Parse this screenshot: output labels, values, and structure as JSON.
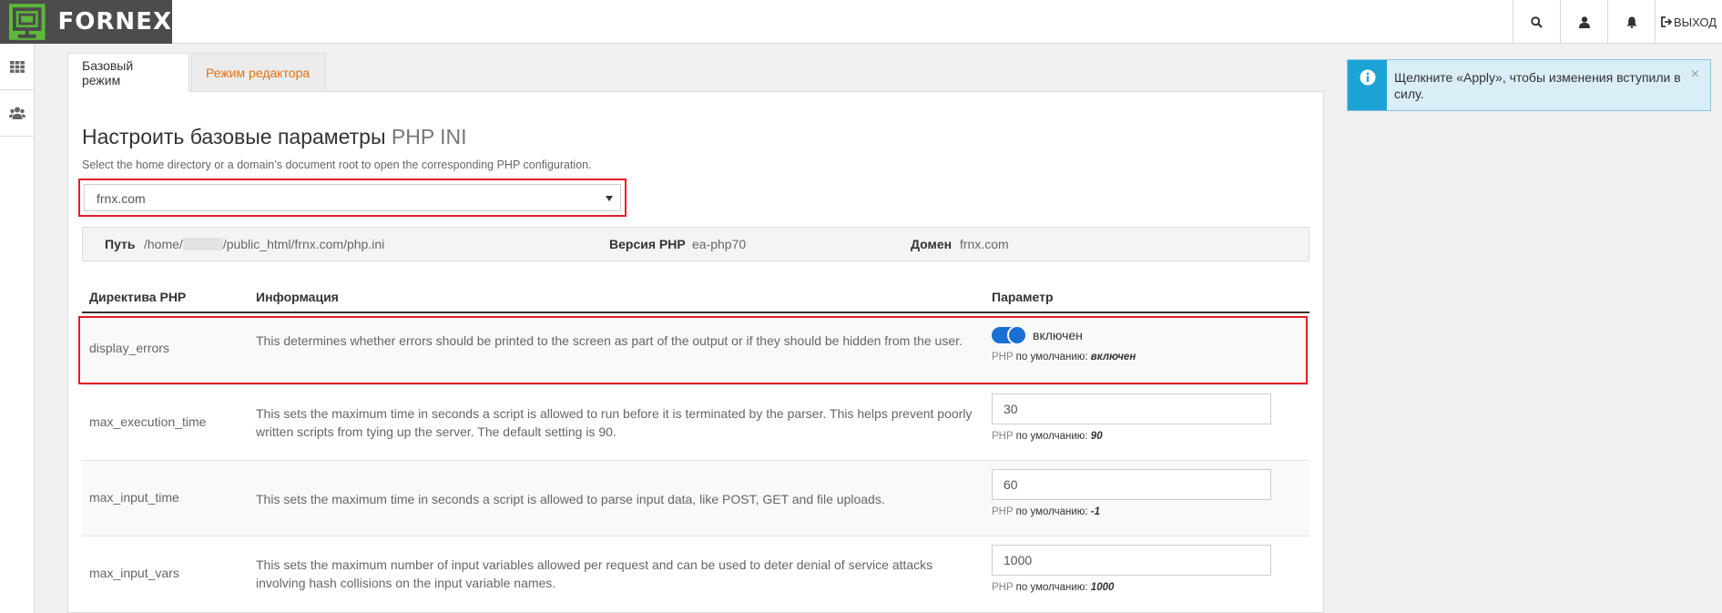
{
  "brand": {
    "name": "FORNEX"
  },
  "topbar": {
    "logout_label": "ВЫХОД"
  },
  "tabs": [
    {
      "label": "Базовый режим"
    },
    {
      "label": "Режим редактора"
    }
  ],
  "page": {
    "title": "Настроить базовые параметры",
    "title_suffix": "PHP INI",
    "help": "Select the home directory or a domain’s document root to open the corresponding PHP configuration."
  },
  "selector": {
    "value": "frnx.com"
  },
  "info": {
    "path_label": "Путь",
    "path_prefix": "/home/",
    "path_suffix": "/public_html/frnx.com/php.ini",
    "version_label": "Версия PHP",
    "version_value": "ea-php70",
    "domain_label": "Домен",
    "domain_value": "frnx.com"
  },
  "table": {
    "headers": [
      "Директива PHP",
      "Информация",
      "Параметр"
    ],
    "default_prefix": "PHP",
    "default_label": "по умолчанию:",
    "rows": [
      {
        "name": "display_errors",
        "info": "This determines whether errors should be printed to the screen as part of the output or if they should be hidden from the user.",
        "value": "включен",
        "default": "включен"
      },
      {
        "name": "max_execution_time",
        "info": "This sets the maximum time in seconds a script is allowed to run before it is terminated by the parser. This helps prevent poorly written scripts from tying up the server. The default setting is 90.",
        "value": "30",
        "default": "90"
      },
      {
        "name": "max_input_time",
        "info": "This sets the maximum time in seconds a script is allowed to parse input data, like POST, GET and file uploads.",
        "value": "60",
        "default": "-1"
      },
      {
        "name": "max_input_vars",
        "info": "This sets the maximum number of input variables allowed per request and can be used to deter denial of service attacks involving hash collisions on the input variable names.",
        "value": "1000",
        "default": "1000"
      }
    ]
  },
  "alert": {
    "text": "Щелкните «Apply», чтобы изменения вступили в силу."
  },
  "colors": {
    "brand_bg": "#4c4c4c",
    "brand_green": "#5fb83b",
    "accent_orange": "#e2700f",
    "highlight_red": "#e41e26",
    "toggle_blue": "#1a6fd4",
    "alert_blue": "#1ea3d6"
  }
}
